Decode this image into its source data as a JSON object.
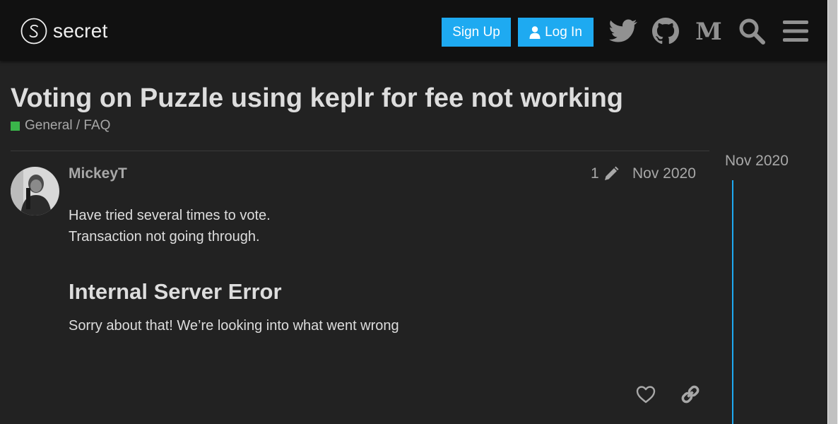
{
  "header": {
    "logo_text": "secret",
    "signup_label": "Sign Up",
    "login_label": "Log In",
    "icons": [
      "twitter-icon",
      "github-icon",
      "medium-icon",
      "search-icon",
      "menu-icon"
    ]
  },
  "topic": {
    "title": "Voting on Puzzle using keplr for fee not working",
    "category": "General / FAQ",
    "category_color": "#3ab54a"
  },
  "post": {
    "username": "MickeyT",
    "edit_count": "1",
    "date": "Nov 2020",
    "lines": [
      "Have tried several times to vote.",
      "Transaction not going through."
    ],
    "error_title": "Internal Server Error",
    "error_text": "Sorry about that! We’re looking into what went wrong"
  },
  "timeline": {
    "date": "Nov 2020"
  },
  "colors": {
    "accent": "#1eaaf1",
    "background": "#222222",
    "header": "#111111"
  }
}
